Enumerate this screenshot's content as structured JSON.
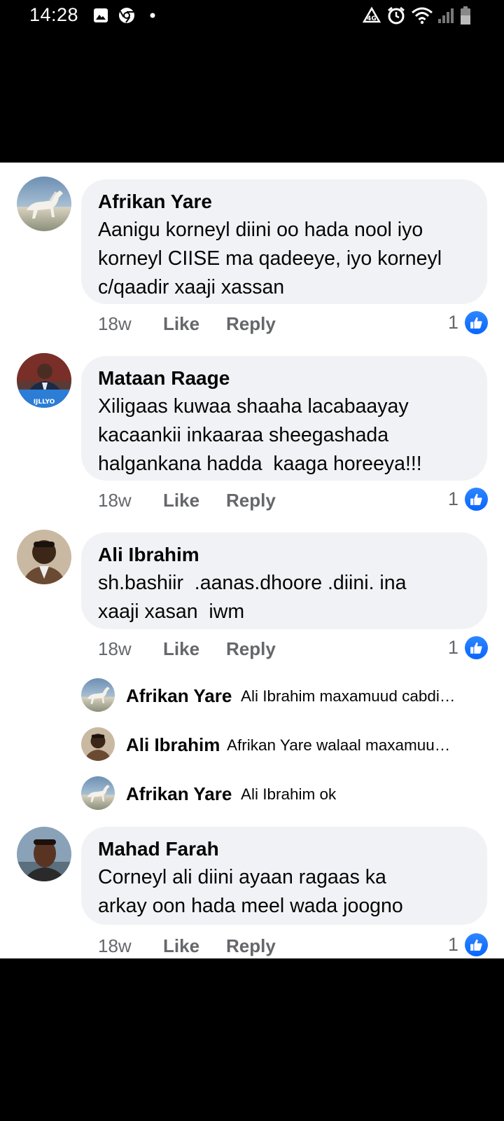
{
  "status_bar": {
    "time": "14:28",
    "left_icons": [
      "image-icon",
      "chrome-icon",
      "dot-icon"
    ],
    "right_icons": [
      "data-saver-icon",
      "alarm-icon",
      "wifi-icon",
      "signal-icon",
      "battery-icon"
    ]
  },
  "comments": [
    {
      "author": "Afrikan Yare",
      "lines": [
        "Aanigu korneyl diini oo hada nool iyo",
        "korneyl CIISE ma qadeeye, iyo korneyl",
        "c/qaadir xaaji xassan"
      ],
      "time": "18w",
      "like_label": "Like",
      "reply_label": "Reply",
      "reaction_count": "1",
      "avatar": "horse-avatar"
    },
    {
      "author": "Mataan Raage",
      "lines": [
        "Xiligaas kuwaa shaaha lacabaayay",
        "kacaankii inkaaraa sheegashada",
        "halgankana hadda  kaaga horeeya!!!"
      ],
      "time": "18w",
      "like_label": "Like",
      "reply_label": "Reply",
      "reaction_count": "1",
      "avatar": "man-suit-flag-avatar",
      "avatar_text": "IJLLYO"
    },
    {
      "author": "Ali Ibrahim",
      "lines": [
        "sh.bashiir  .aanas.dhoore .diini. ina",
        "xaaji xasan  iwm"
      ],
      "time": "18w",
      "like_label": "Like",
      "reply_label": "Reply",
      "reaction_count": "1",
      "avatar": "man-portrait-avatar"
    },
    {
      "author": "Mahad Farah",
      "lines": [
        "Corneyl ali diini ayaan ragaas ka",
        "arkay oon hada meel wada joogno"
      ],
      "time": "18w",
      "like_label": "Like",
      "reply_label": "Reply",
      "reaction_count": "1",
      "avatar": "man-selfie-avatar"
    }
  ],
  "replies": [
    {
      "author": "Afrikan Yare",
      "text": "Ali Ibrahim maxamuud cabdi…",
      "avatar": "horse-avatar"
    },
    {
      "author": "Ali Ibrahim",
      "text": "Afrikan Yare  walaal  maxamuu…",
      "avatar": "man-portrait-avatar"
    },
    {
      "author": "Afrikan Yare",
      "text": "Ali Ibrahim ok",
      "avatar": "horse-avatar"
    }
  ],
  "colors": {
    "bubble": "#f0f2f5",
    "meta_text": "#65676b",
    "like_blue": "#0866ff"
  }
}
